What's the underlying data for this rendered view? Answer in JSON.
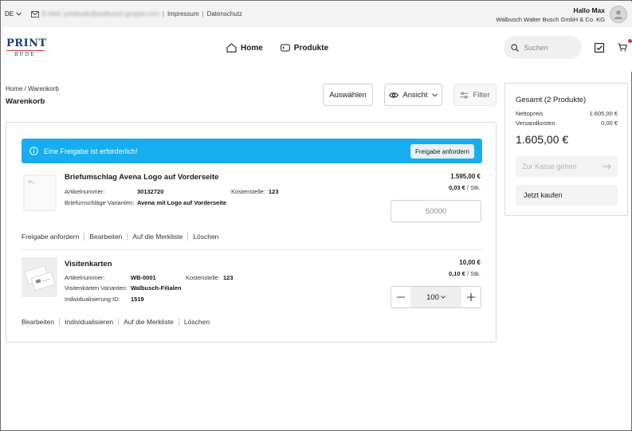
{
  "topbar": {
    "language": "DE",
    "email_masked": "E-Mail: printbude@walbusch-gruppe.com",
    "links": [
      "Impressum",
      "Datenschutz"
    ],
    "greeting": "Hallo Max",
    "company": "Walbusch Walter Busch GmbH & Co. KG"
  },
  "header": {
    "logo_top": "PRINT",
    "logo_bottom": "BUDE",
    "nav": [
      {
        "label": "Home",
        "icon": "home-icon"
      },
      {
        "label": "Produkte",
        "icon": "tag-icon"
      }
    ],
    "search_placeholder": "Suchen",
    "has_cart_notification": true
  },
  "page": {
    "breadcrumb": "Home / Warenkorb",
    "title": "Warenkorb",
    "buttons": {
      "select": "Auswählen",
      "view": "Ansicht",
      "filter": "Filter"
    }
  },
  "cart": {
    "alert": {
      "text": "Eine Freigabe ist erforderlich!",
      "button": "Freigabe anfordern"
    },
    "items": [
      {
        "title": "Briefumschlag Avena Logo auf Vorderseite",
        "art_label": "Artikelnummer:",
        "art_value": "30132720",
        "cost_label": "Kostenstelle:",
        "cost_value": "123",
        "variant_label": "Briefumschläge Varianten:",
        "variant_value": "Avena mit Logo auf Vorderseite",
        "price_total": "1.595,00 €",
        "price_unit_value": "0,03 €",
        "price_unit_suffix": " / Stk.",
        "quantity_placeholder": "50000",
        "actions": [
          "Freigabe anfordern",
          "Bearbeiten",
          "Auf die Merkliste",
          "Löschen"
        ]
      },
      {
        "title": "Visitenkarten",
        "art_label": "Artikelnummer:",
        "art_value": "WB-0001",
        "cost_label": "Kostenstelle:",
        "cost_value": "123",
        "variant_label": "Visitenkarten Varianten:",
        "variant_value": "Walbusch-Filialen",
        "indiv_label": "Individualisierung ID:",
        "indiv_value": "1519",
        "price_total": "10,00 €",
        "price_unit_value": "0,10 €",
        "price_unit_suffix": " / Stk.",
        "quantity": "100",
        "actions": [
          "Bearbeiten",
          "Individualisieren",
          "Auf die Merkliste",
          "Löschen"
        ]
      }
    ]
  },
  "summary": {
    "title": "Gesamt (2 Produkte)",
    "net_label": "Nettopreis",
    "net_value": "1.605,00 €",
    "shipping_label": "Versandkosten",
    "shipping_value": "0,00 €",
    "total": "1.605,00 €",
    "checkout_label": "Zur Kasse gehen",
    "buy_label": "Jetzt kaufen"
  },
  "colors": {
    "alert": "#16aef0",
    "logo": "#1d3a7a",
    "notification": "#e0245e"
  }
}
